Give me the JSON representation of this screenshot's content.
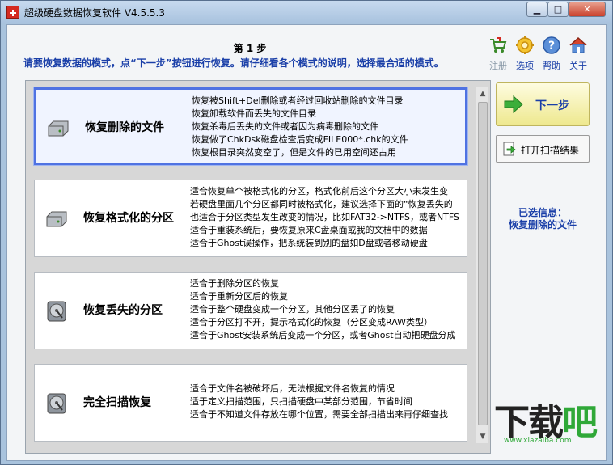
{
  "window": {
    "title": "超级硬盘数据恢复软件 V4.5.5.3",
    "controls": {
      "minimize": "▁",
      "maximize": "□",
      "close": "✕"
    }
  },
  "header": {
    "step": "第 1 步",
    "instruction": "请要恢复数据的模式，点“下一步”按钮进行恢复。请仔细看各个模式的说明，选择最合适的模式。"
  },
  "toolbar": [
    {
      "label": "注册",
      "icon": "cart-icon",
      "disabled": true
    },
    {
      "label": "选项",
      "icon": "gear-icon",
      "disabled": false
    },
    {
      "label": "帮助",
      "icon": "help-icon",
      "disabled": false
    },
    {
      "label": "关于",
      "icon": "house-icon",
      "disabled": false
    }
  ],
  "modes": [
    {
      "title": "恢复删除的文件",
      "selected": true,
      "icon": "drive-icon",
      "desc": [
        "恢复被Shift+Del删除或者经过回收站删除的文件目录",
        "恢复卸载软件而丢失的文件目录",
        "恢复杀毒后丢失的文件或者因为病毒删除的文件",
        "恢复做了ChkDsk磁盘检查后变成FILE000*.chk的文件",
        "恢复根目录突然变空了，但是文件的已用空间还占用"
      ]
    },
    {
      "title": "恢复格式化的分区",
      "selected": false,
      "icon": "drive-icon",
      "desc": [
        "适合恢复单个被格式化的分区，格式化前后这个分区大小未发生变",
        "若硬盘里面几个分区都同时被格式化，建议选择下面的“恢复丢失的",
        "也适合于分区类型发生改变的情况，比如FAT32->NTFS，或者NTFS",
        "适合于重装系统后，要恢复原来C盘桌面或我的文档中的数据",
        "适合于Ghost误操作，把系统装到别的盘如D盘或者移动硬盘"
      ]
    },
    {
      "title": "恢复丢失的分区",
      "selected": false,
      "icon": "disk-icon",
      "desc": [
        "适合于删除分区的恢复",
        "适合于重新分区后的恢复",
        "适合于整个硬盘变成一个分区，其他分区丢了的恢复",
        "适合于分区打不开，提示格式化的恢复（分区变成RAW类型）",
        "适合于Ghost安装系统后变成一个分区，或者Ghost自动把硬盘分成"
      ]
    },
    {
      "title": "完全扫描恢复",
      "selected": false,
      "icon": "disk-icon",
      "desc": [
        "适合于文件名被破坏后，无法根据文件名恢复的情况",
        "适于定义扫描范围，只扫描硬盘中某部分范围，节省时间",
        "适合于不知道文件存放在哪个位置，需要全部扫描出来再仔细查找"
      ]
    }
  ],
  "actions": {
    "next": "下一步",
    "open_scan": "打开扫描结果"
  },
  "selected_info": {
    "label": "已选信息：",
    "value": "恢复删除的文件"
  },
  "watermark": {
    "text_main": "下载",
    "text_accent": "吧",
    "url": "www.xiazaiba.com"
  },
  "colors": {
    "accent_blue": "#1a3fa8",
    "selection_border": "#4f72e2",
    "next_button": "#eee88e"
  }
}
